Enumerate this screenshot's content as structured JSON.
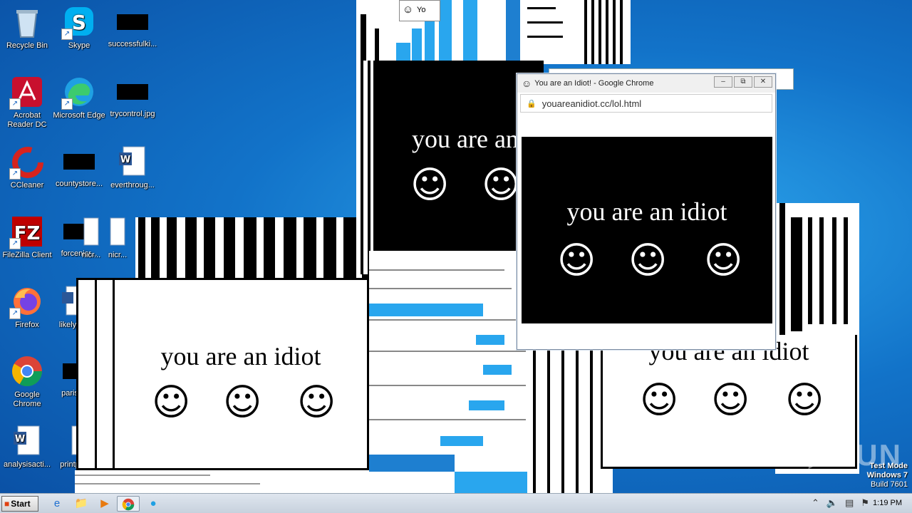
{
  "desktop": {
    "icons": [
      {
        "label": "Recycle Bin",
        "icon": "recycle-bin-icon"
      },
      {
        "label": "Skype",
        "icon": "skype-icon"
      },
      {
        "label": "successfulki...",
        "icon": "black-thumbnail-icon"
      },
      {
        "label": "Acrobat Reader DC",
        "icon": "acrobat-icon"
      },
      {
        "label": "Microsoft Edge",
        "icon": "edge-icon"
      },
      {
        "label": "trycontrol.jpg",
        "icon": "black-thumbnail-icon"
      },
      {
        "label": "CCleaner",
        "icon": "ccleaner-icon"
      },
      {
        "label": "countystore...",
        "icon": "black-thumbnail-icon"
      },
      {
        "label": "everthroug...",
        "icon": "word-doc-icon"
      },
      {
        "label": "FileZilla Client",
        "icon": "filezilla-icon"
      },
      {
        "label": "forcenicr...",
        "icon": "black-thumbnail-icon"
      },
      {
        "label": "nicr...",
        "icon": "document-icon"
      },
      {
        "label": "nicr...",
        "icon": "document-icon"
      },
      {
        "label": "Firefox",
        "icon": "firefox-icon"
      },
      {
        "label": "likelyp",
        "icon": "word-doc-icon"
      },
      {
        "label": "Google Chrome",
        "icon": "chrome-icon"
      },
      {
        "label": "paris",
        "icon": "black-thumbnail-icon"
      },
      {
        "label": "analysisacti...",
        "icon": "word-doc-icon"
      },
      {
        "label": "printp",
        "icon": "document-icon"
      }
    ]
  },
  "idiot_message": "you are an idiot",
  "partial_message": "you are an",
  "mini_window_title": "Yo",
  "chrome_window": {
    "title": "You are an Idiot! - Google Chrome",
    "url": "youareanidiot.cc/lol.html",
    "minimize": "–",
    "restore": "⧉",
    "close": "✕",
    "message": "you are an idiot"
  },
  "smiley_glyph": "☺",
  "taskbar": {
    "start_label": "Start",
    "clock": "1:19 PM",
    "pinned": [
      "ie-icon",
      "explorer-icon",
      "media-player-icon",
      "chrome-icon",
      "edge-icon"
    ]
  },
  "watermark": {
    "line1": "Test Mode",
    "line2": "Windows 7",
    "line3": "Build 7601",
    "brand": "ANY▷RUN"
  }
}
